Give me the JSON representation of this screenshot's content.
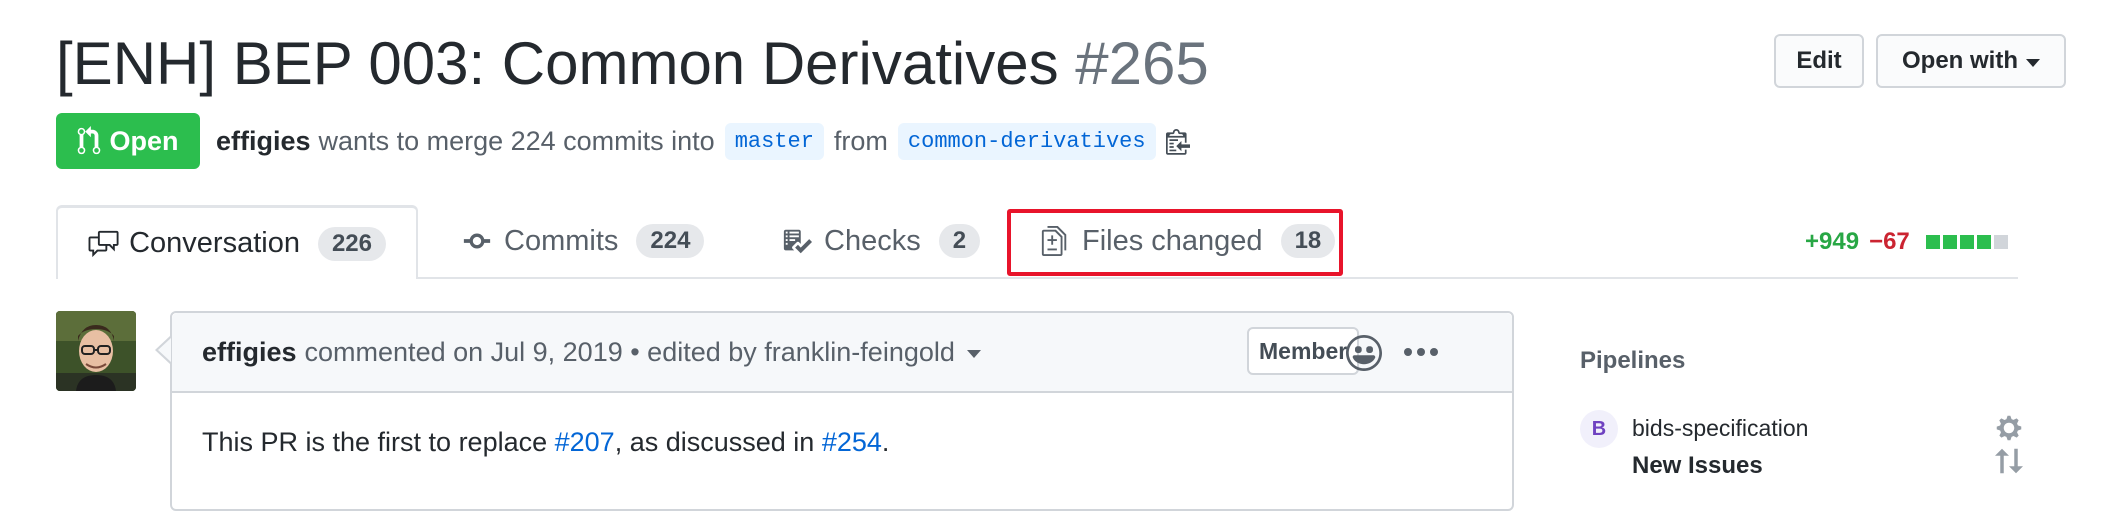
{
  "pr": {
    "title": "[ENH] BEP 003: Common Derivatives",
    "number": "#265",
    "state": "Open",
    "author": "effigies",
    "merge_text": "wants to merge 224 commits into",
    "base_branch": "master",
    "from_text": "from",
    "head_branch": "common-derivatives"
  },
  "header_actions": {
    "edit_label": "Edit",
    "open_with_label": "Open with"
  },
  "tabs": [
    {
      "label": "Conversation",
      "count": "226",
      "icon": "comment-discussion-icon",
      "selected": true
    },
    {
      "label": "Commits",
      "count": "224",
      "icon": "git-commit-icon",
      "selected": false
    },
    {
      "label": "Checks",
      "count": "2",
      "icon": "checklist-icon",
      "selected": false
    },
    {
      "label": "Files changed",
      "count": "18",
      "icon": "file-diff-icon",
      "selected": false,
      "highlighted": true
    }
  ],
  "diffstat": {
    "additions": "+949",
    "deletions": "−67",
    "blocks": [
      "add",
      "add",
      "add",
      "add",
      "neutral"
    ]
  },
  "comment": {
    "author": "effigies",
    "action": "commented on Jul 9, 2019 • edited by franklin-feingold",
    "role": "Member",
    "body_prefix": "This PR is the first to replace ",
    "link1": "#207",
    "body_middle": ", as discussed in ",
    "link2": "#254",
    "body_suffix": "."
  },
  "sidebar": {
    "pipelines_title": "Pipelines",
    "pipeline_badge": "B",
    "pipeline_repo": "bids-specification",
    "pipeline_status": "New Issues"
  },
  "colors": {
    "open_green": "#2cbe4e",
    "link_blue": "#0366d6",
    "highlight_red": "#e8142b",
    "add_green": "#28a745",
    "del_red": "#cb2431"
  }
}
